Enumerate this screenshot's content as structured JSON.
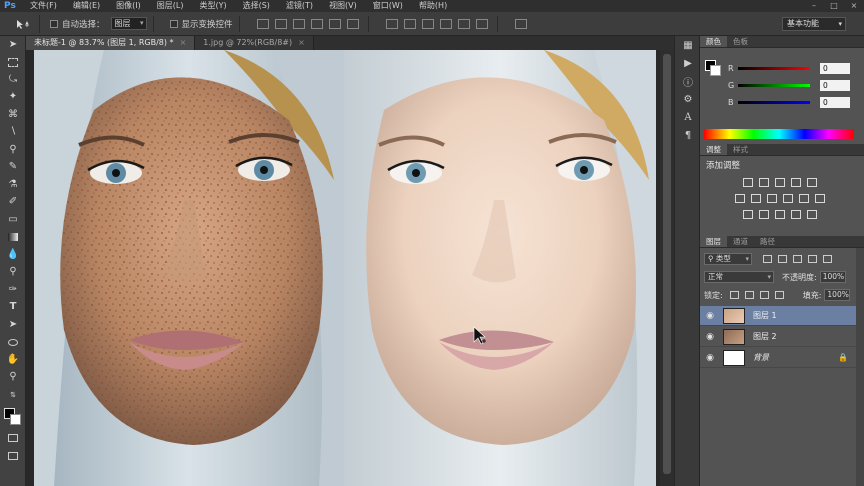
{
  "app": {
    "logo": "Ps",
    "menus": [
      "文件(F)",
      "编辑(E)",
      "图像(I)",
      "图层(L)",
      "类型(Y)",
      "选择(S)",
      "滤镜(T)",
      "视图(V)",
      "窗口(W)",
      "帮助(H)"
    ],
    "window_controls": [
      "–",
      "□",
      "×"
    ]
  },
  "options": {
    "auto_select_label": "自动选择：",
    "auto_select_target": "图层",
    "show_transform_label": "显示变换控件",
    "workspace": "基本功能"
  },
  "tabs": [
    {
      "label": "未标题-1 @ 83.7% (图层 1, RGB/8) *",
      "close": "×"
    },
    {
      "label": "1.jpg @ 72%(RGB/8#)",
      "close": "×"
    }
  ],
  "color_panel": {
    "tabs": [
      "颜色",
      "色板"
    ],
    "channels": [
      {
        "label": "R",
        "value": "0"
      },
      {
        "label": "G",
        "value": "0"
      },
      {
        "label": "B",
        "value": "0"
      }
    ],
    "channel_colors": [
      "#e03030",
      "#30c030",
      "#2060e0"
    ]
  },
  "adjust_panel": {
    "tabs": [
      "调整",
      "样式"
    ],
    "title": "添加调整"
  },
  "layers_panel": {
    "tabs": [
      "图层",
      "通道",
      "路径"
    ],
    "filter_kind": "类型",
    "blend_mode": "正常",
    "opacity_label": "不透明度:",
    "opacity_value": "100%",
    "lock_label": "锁定:",
    "fill_label": "填充:",
    "fill_value": "100%",
    "layers": [
      {
        "name": "图层 1",
        "selected": true
      },
      {
        "name": "图层 2",
        "selected": false
      },
      {
        "name": "背景",
        "selected": false,
        "locked": true
      }
    ]
  }
}
